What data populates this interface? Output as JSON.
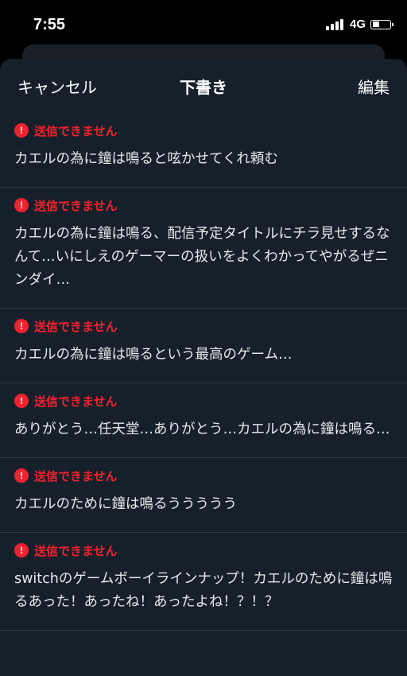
{
  "status_bar": {
    "time": "7:55",
    "network": "4G",
    "icons": [
      "signal-icon",
      "battery-icon"
    ],
    "battery_level": 0.4
  },
  "header": {
    "cancel_label": "キャンセル",
    "title": "下書き",
    "edit_label": "編集"
  },
  "colors": {
    "error": "#f4212e",
    "sheet_background": "#15202b",
    "divider": "#2f3b47"
  },
  "drafts": [
    {
      "error_icon": "!",
      "error": "送信できません",
      "text": "カエルの為に鐘は鳴ると呟かせてくれ頼む"
    },
    {
      "error_icon": "!",
      "error": "送信できません",
      "text": "カエルの為に鐘は鳴る、配信予定タイトルにチラ見せするなんて…いにしえのゲーマーの扱いをよくわかってやがるぜニンダイ…"
    },
    {
      "error_icon": "!",
      "error": "送信できません",
      "text": "カエルの為に鐘は鳴るという最高のゲーム…"
    },
    {
      "error_icon": "!",
      "error": "送信できません",
      "text": "ありがとう…任天堂…ありがとう…カエルの為に鐘は鳴る…"
    },
    {
      "error_icon": "!",
      "error": "送信できません",
      "text": "カエルのために鐘は鳴るううううう"
    },
    {
      "error_icon": "!",
      "error": "送信できません",
      "text": "switchのゲームボーイラインナップ！カエルのために鐘は鳴るあった！あったね！あったよね！？！？"
    }
  ]
}
